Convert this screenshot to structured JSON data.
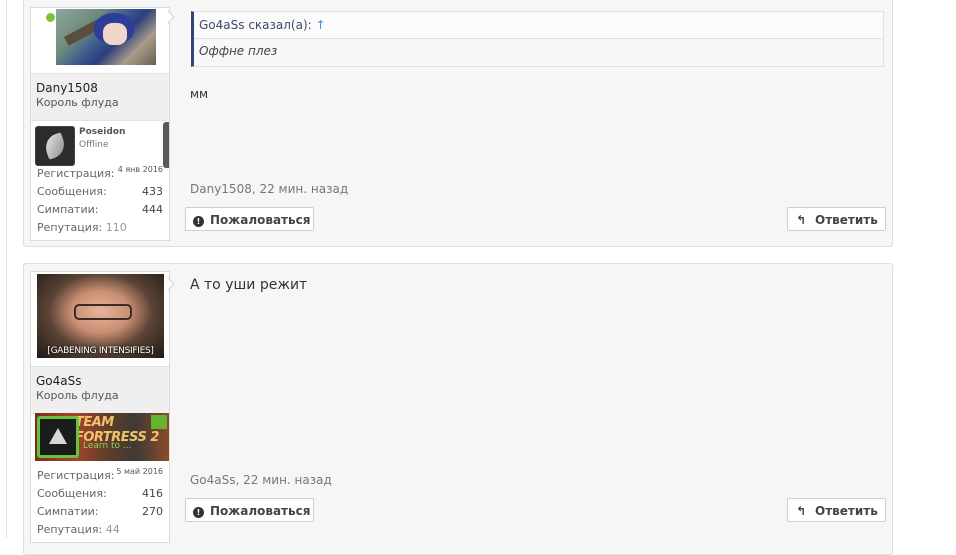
{
  "posts": [
    {
      "user": {
        "name": "Dany1508",
        "title": "Король флуда",
        "online": true,
        "avatar_icon": "anime-avatar",
        "game": {
          "name": "Poseidon",
          "status": "Offline",
          "icon": "game-axe-icon"
        },
        "stats": {
          "reg_label": "Регистрация:",
          "reg_value": "4 янв 2016",
          "messages_label": "Сообщения:",
          "messages_value": "433",
          "likes_label": "Симпатии:",
          "likes_value": "444",
          "rep_label": "Репутация:",
          "rep_value": "110"
        }
      },
      "quote": {
        "author": "Go4aSs сказал(а):",
        "arrow": "↑",
        "text": "Оффне плез"
      },
      "message": "мм",
      "meta": "Dany1508, 22 мин. назад",
      "report_label": "Пожаловаться",
      "reply_label": "Ответить"
    },
    {
      "user": {
        "name": "Go4aSs",
        "title": "Король флуда",
        "avatar_icon": "gaben-avatar",
        "avatar_caption": "[GABENING INTENSIFIES]",
        "game": {
          "banner": "TEAM FORTRESS 2",
          "banner_sub": "Learn to ...",
          "icon": "game-tf2-icon"
        },
        "stats": {
          "reg_label": "Регистрация:",
          "reg_value": "5 май 2016",
          "messages_label": "Сообщения:",
          "messages_value": "416",
          "likes_label": "Симпатии:",
          "likes_value": "270",
          "rep_label": "Репутация:",
          "rep_value": "44"
        }
      },
      "message": "А то уши режит",
      "meta": "Go4aSs, 22 мин. назад",
      "report_label": "Пожаловаться",
      "reply_label": "Ответить"
    }
  ],
  "icons": {
    "report": "warning-circle-icon",
    "reply": "reply-arrow-icon"
  },
  "colors": {
    "online": "#7cc438",
    "quote_border": "#34447a",
    "link": "#4a90d9"
  }
}
